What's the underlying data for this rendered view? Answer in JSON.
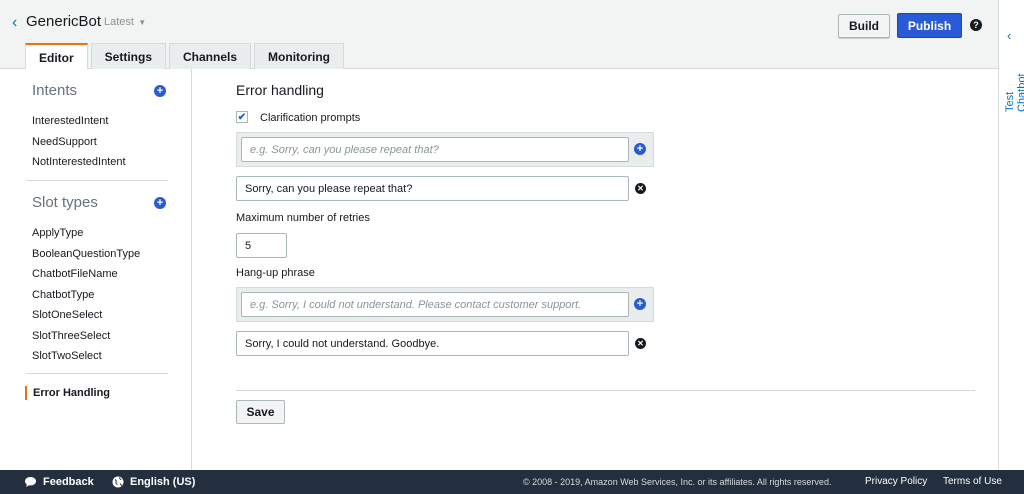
{
  "header": {
    "bot_name": "GenericBot",
    "version": "Latest",
    "build_label": "Build",
    "publish_label": "Publish",
    "help_symbol": "?"
  },
  "tabs": [
    {
      "label": "Editor",
      "active": true
    },
    {
      "label": "Settings",
      "active": false
    },
    {
      "label": "Channels",
      "active": false
    },
    {
      "label": "Monitoring",
      "active": false
    }
  ],
  "right_rail": {
    "label": "Test Chatbot"
  },
  "sidebar": {
    "intents_heading": "Intents",
    "intents": [
      "InterestedIntent",
      "NeedSupport",
      "NotInterestedIntent"
    ],
    "slot_types_heading": "Slot types",
    "slot_types": [
      "ApplyType",
      "BooleanQuestionType",
      "ChatbotFileName",
      "ChatbotType",
      "SlotOneSelect",
      "SlotThreeSelect",
      "SlotTwoSelect"
    ],
    "active_item": "Error Handling"
  },
  "main": {
    "title": "Error handling",
    "clarification_label": "Clarification prompts",
    "clarification_checked": true,
    "clarification_placeholder": "e.g. Sorry, can you please repeat that?",
    "clarification_value": "Sorry, can you please repeat that?",
    "retries_label": "Maximum number of retries",
    "retries_value": "5",
    "hangup_label": "Hang-up phrase",
    "hangup_placeholder": "e.g. Sorry, I could not understand. Please contact customer support.",
    "hangup_value": "Sorry, I could not understand. Goodbye.",
    "save_label": "Save"
  },
  "footer": {
    "feedback": "Feedback",
    "language": "English (US)",
    "copyright": "© 2008 - 2019, Amazon Web Services, Inc. or its affiliates. All rights reserved.",
    "privacy": "Privacy Policy",
    "terms": "Terms of Use"
  },
  "colors": {
    "accent_orange": "#ec7211",
    "primary_blue": "#2a5bd7",
    "link_blue": "#0073bb",
    "footer_bg": "#232f3e"
  }
}
